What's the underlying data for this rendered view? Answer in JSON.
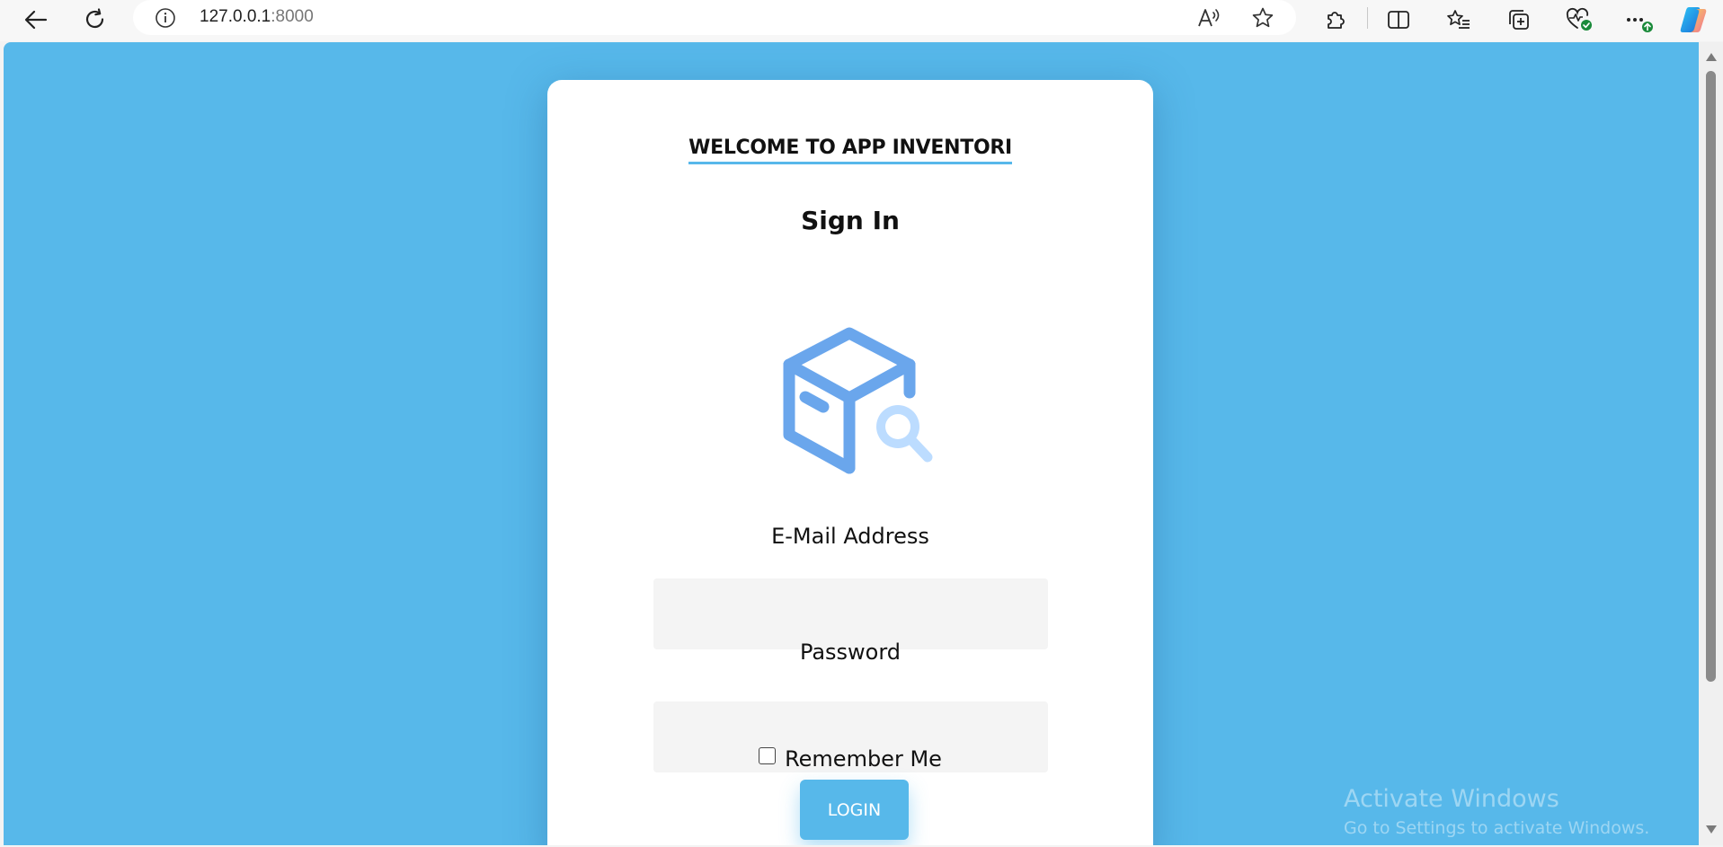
{
  "browser": {
    "url_host": "127.0.0.1",
    "url_port": ":8000",
    "icons": {
      "back": "arrow-left-icon",
      "refresh": "refresh-icon",
      "site_info": "info-icon",
      "read_aloud": "read-aloud-icon",
      "favorite": "star-icon",
      "extensions": "puzzle-icon",
      "split_screen": "split-screen-icon",
      "favorites": "favorites-list-icon",
      "collections": "collections-icon",
      "browser_essentials": "heart-pulse-icon",
      "more": "ellipsis-icon",
      "copilot": "copilot-icon"
    }
  },
  "page": {
    "background_color": "#57b8ea",
    "welcome_title": "WELCOME TO APP INVENTORI",
    "signin_title": "Sign In",
    "logo_icon": "box-search-icon",
    "email_label": "E-Mail Address",
    "email_value": "",
    "password_label": "Password",
    "password_value": "",
    "remember_label": "Remember Me",
    "remember_checked": false,
    "login_label": "LOGIN"
  },
  "watermark": {
    "title": "Activate Windows",
    "subtitle": "Go to Settings to activate Windows."
  }
}
